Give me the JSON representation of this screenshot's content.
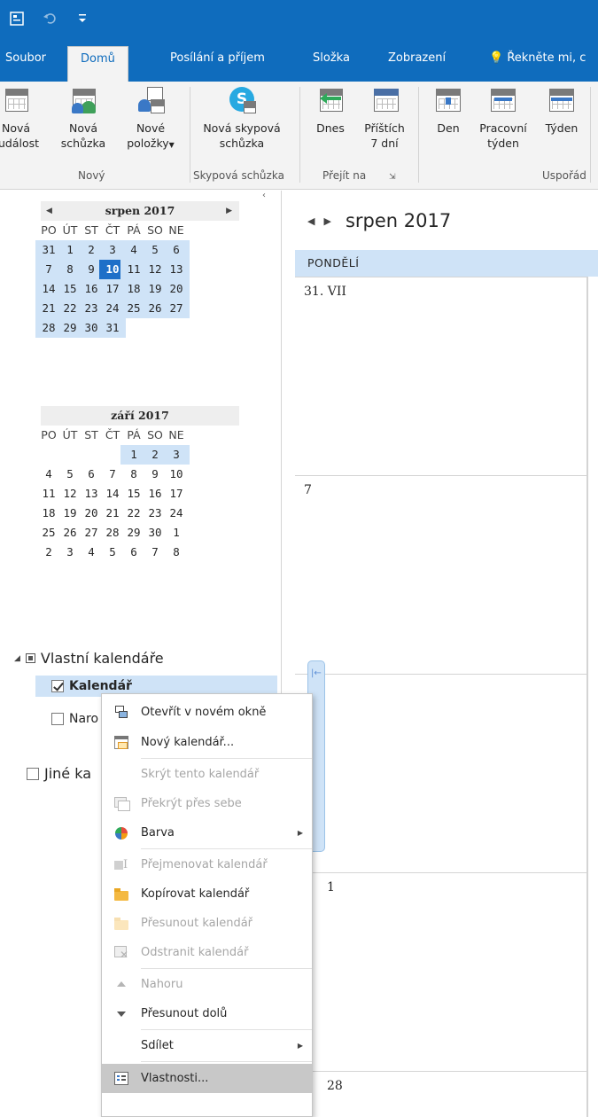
{
  "ribbon_tabs": [
    "Soubor",
    "Domů",
    "Posílání a příjem",
    "Složka",
    "Zobrazení"
  ],
  "tell_me": "Řekněte mi, c",
  "ribbon": {
    "new_event": [
      "Nová",
      "událost"
    ],
    "new_meeting": [
      "Nová",
      "schůzka"
    ],
    "new_items": [
      "Nové",
      "položky"
    ],
    "skype_meeting": [
      "Nová skypová",
      "schůzka"
    ],
    "today": "Dnes",
    "next7": [
      "Příštích",
      "7 dní"
    ],
    "day": "Den",
    "work_week": [
      "Pracovní",
      "týden"
    ],
    "week": "Týden",
    "groups": [
      "Nový",
      "Skypová schůzka",
      "Přejít na",
      "Uspořád"
    ]
  },
  "mini1": {
    "title": "srpen 2017",
    "dow": [
      "PO",
      "ÚT",
      "ST",
      "ČT",
      "PÁ",
      "SO",
      "NE"
    ],
    "weeks": [
      [
        "31",
        "1",
        "2",
        "3",
        "4",
        "5",
        "6"
      ],
      [
        "7",
        "8",
        "9",
        "10",
        "11",
        "12",
        "13"
      ],
      [
        "14",
        "15",
        "16",
        "17",
        "18",
        "19",
        "20"
      ],
      [
        "21",
        "22",
        "23",
        "24",
        "25",
        "26",
        "27"
      ],
      [
        "28",
        "29",
        "30",
        "31",
        "",
        "",
        ""
      ]
    ],
    "today": "10"
  },
  "mini2": {
    "title": "září 2017",
    "weeks": [
      [
        "",
        "",
        "",
        "",
        "1",
        "2",
        "3"
      ],
      [
        "4",
        "5",
        "6",
        "7",
        "8",
        "9",
        "10"
      ],
      [
        "11",
        "12",
        "13",
        "14",
        "15",
        "16",
        "17"
      ],
      [
        "18",
        "19",
        "20",
        "21",
        "22",
        "23",
        "24"
      ],
      [
        "25",
        "26",
        "27",
        "28",
        "29",
        "30",
        "1"
      ],
      [
        "2",
        "3",
        "4",
        "5",
        "6",
        "7",
        "8"
      ]
    ]
  },
  "folders": {
    "own_header": "Vlastní kalendáře",
    "calendar": "Kalendář",
    "birthdays_partial": "Naro",
    "other_partial": "Jiné ka"
  },
  "main": {
    "title": "srpen 2017",
    "day_header": "PONDĚLÍ",
    "week_labels": [
      "31. VII",
      "7",
      "",
      "1",
      "28"
    ]
  },
  "context_menu": [
    {
      "label": "Otevřít v novém okně",
      "icon": "open-window-icon",
      "enabled": true
    },
    {
      "label": "Nový kalendář...",
      "icon": "new-calendar-icon",
      "enabled": true
    },
    {
      "label": "Skrýt tento kalendář",
      "icon": "",
      "enabled": false
    },
    {
      "label": "Překrýt přes sebe",
      "icon": "overlay-icon",
      "enabled": false
    },
    {
      "label": "Barva",
      "icon": "color-icon",
      "enabled": true,
      "submenu": true
    },
    {
      "label": "Přejmenovat kalendář",
      "icon": "rename-icon",
      "enabled": false
    },
    {
      "label": "Kopírovat kalendář",
      "icon": "copy-folder-icon",
      "enabled": true
    },
    {
      "label": "Přesunout kalendář",
      "icon": "move-folder-icon",
      "enabled": false
    },
    {
      "label": "Odstranit kalendář",
      "icon": "delete-icon",
      "enabled": false
    },
    {
      "label": "Nahoru",
      "icon": "move-up-icon",
      "enabled": false
    },
    {
      "label": "Přesunout dolů",
      "icon": "move-down-icon",
      "enabled": true
    },
    {
      "label": "Sdílet",
      "icon": "",
      "enabled": true,
      "submenu": true
    },
    {
      "label": "Vlastnosti...",
      "icon": "properties-icon",
      "enabled": true,
      "highlighted": true
    }
  ],
  "colors": {
    "accent": "#0f6cbd",
    "selection": "#cfe3f7",
    "today": "#1e6fc8"
  }
}
